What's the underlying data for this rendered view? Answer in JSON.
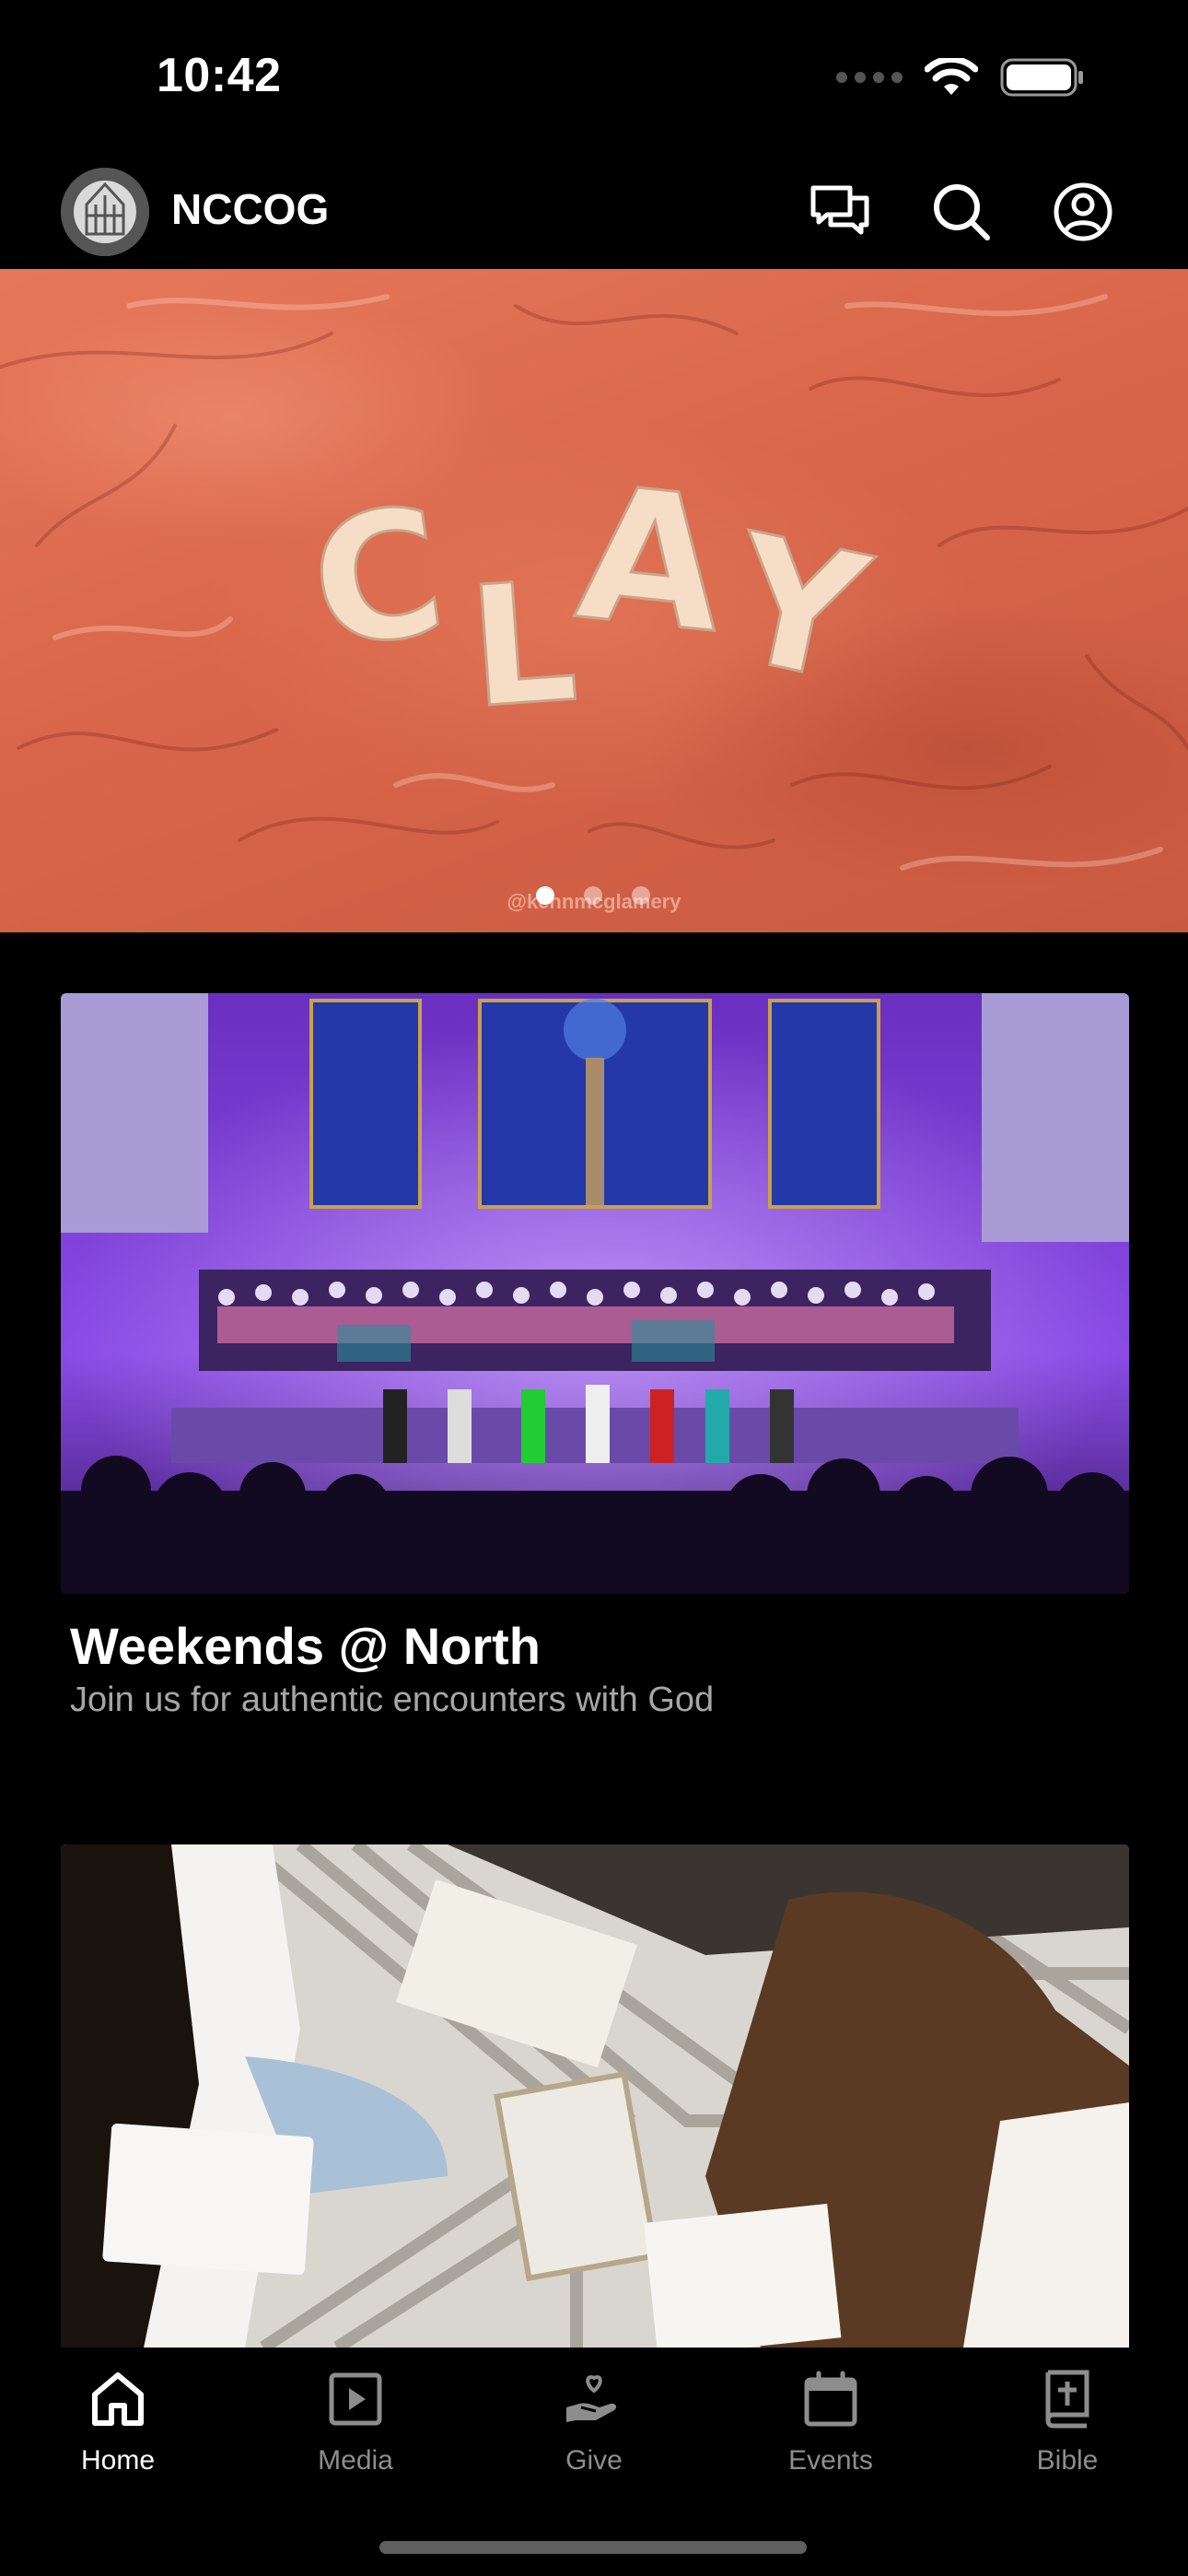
{
  "status_bar": {
    "time": "10:42"
  },
  "header": {
    "app_name": "NCCOG",
    "icons": [
      "chat-bubbles-icon",
      "search-icon",
      "profile-icon"
    ]
  },
  "hero": {
    "word": "CLAY",
    "credit": "@kennmcglamery",
    "carousel": {
      "count": 3,
      "active_index": 0
    }
  },
  "cards": [
    {
      "title": "Weekends @ North",
      "subtitle": "Join us for authentic encounters with God"
    },
    {
      "title": "",
      "subtitle": ""
    }
  ],
  "tab_bar": {
    "items": [
      {
        "label": "Home",
        "icon": "home-icon",
        "active": true
      },
      {
        "label": "Media",
        "icon": "play-square-icon",
        "active": false
      },
      {
        "label": "Give",
        "icon": "hand-heart-icon",
        "active": false
      },
      {
        "label": "Events",
        "icon": "calendar-icon",
        "active": false
      },
      {
        "label": "Bible",
        "icon": "bible-cross-icon",
        "active": false
      }
    ]
  },
  "colors": {
    "background": "#000000",
    "hero_clay": "#d8664a",
    "stage_purple": "#7a3fd6",
    "inactive_tab": "#8d8d8d"
  }
}
